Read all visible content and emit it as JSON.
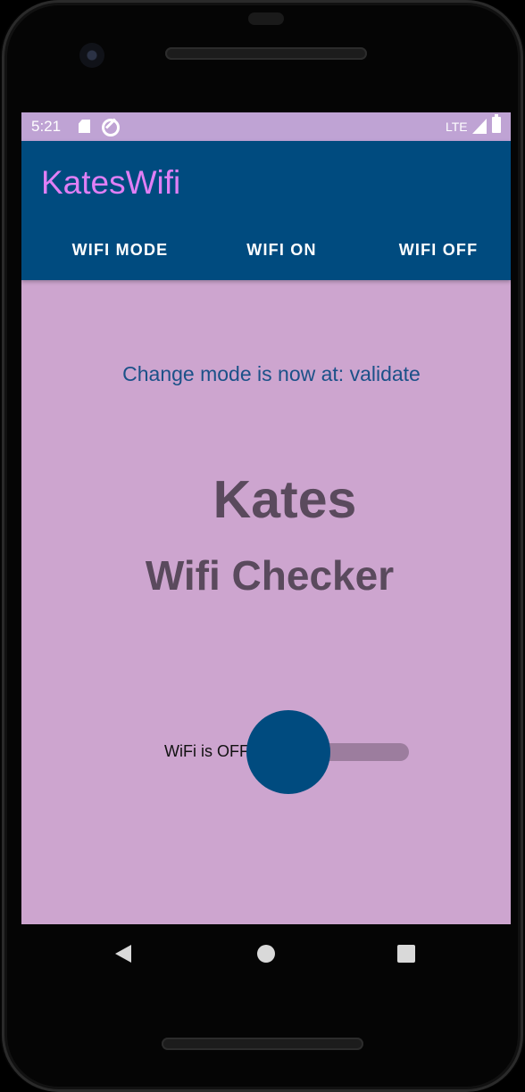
{
  "status_bar": {
    "time": "5:21",
    "network": "LTE",
    "icons": [
      "sd-card-icon",
      "sync-off-icon",
      "signal-icon",
      "battery-icon"
    ]
  },
  "app_bar": {
    "title": "KatesWifi",
    "tabs": [
      {
        "label": "WIFI MODE"
      },
      {
        "label": "WIFI ON"
      },
      {
        "label": "WIFI OFF"
      }
    ]
  },
  "main": {
    "mode_text": "Change mode is now at: validate",
    "title_line1": "Kates",
    "title_line2": "Wifi Checker",
    "switch": {
      "label": "WiFi is OFF",
      "checked": false
    }
  },
  "nav_bar": {
    "icons": [
      "back-icon",
      "home-icon",
      "recents-icon"
    ]
  },
  "colors": {
    "primary": "#004b7f",
    "accent": "#e07ff5",
    "background": "#cda5cf",
    "status_bar": "#bfa3d4",
    "title_text": "#5a4a5d",
    "mode_text": "#1b5188"
  }
}
